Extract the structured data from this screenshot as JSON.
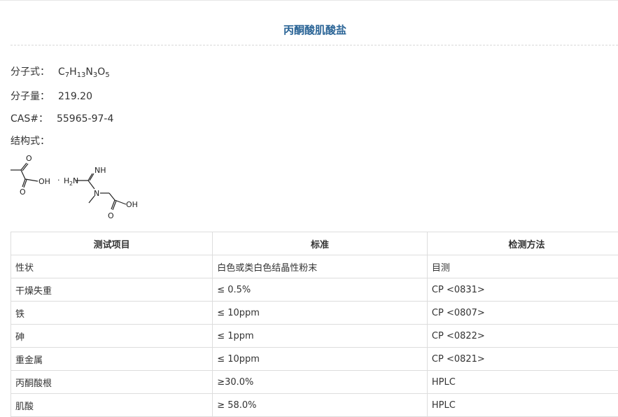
{
  "product": {
    "title": "丙酮酸肌酸盐",
    "formula_label": "分子式：",
    "formula": [
      {
        "t": "C"
      },
      {
        "s": "7"
      },
      {
        "t": "H"
      },
      {
        "s": "13"
      },
      {
        "t": "N"
      },
      {
        "s": "3"
      },
      {
        "t": "O"
      },
      {
        "s": "5"
      }
    ],
    "mw_label": "分子量：",
    "mw": "219.20",
    "cas_label": "CAS#：",
    "cas": "55965-97-4",
    "structure_label": "结构式："
  },
  "structure": {
    "o_top": "O",
    "oh_left": "OH",
    "dot": "·",
    "h2n_h": "H",
    "h2n_2": "2",
    "h2n_n": "N",
    "nh": "NH",
    "n": "N",
    "o_bottom": "O",
    "oh_right": "OH"
  },
  "spec_table": {
    "headers": [
      "测试项目",
      "标准",
      "检测方法"
    ],
    "rows": [
      [
        "性状",
        "白色或类白色结晶性粉末",
        "目测"
      ],
      [
        "干燥失重",
        "≤ 0.5%",
        "CP <0831>"
      ],
      [
        "铁",
        "≤ 10ppm",
        "CP <0807>"
      ],
      [
        "砷",
        "≤ 1ppm",
        "CP <0822>"
      ],
      [
        "重金属",
        "≤ 10ppm",
        "CP <0821>"
      ],
      [
        "丙酮酸根",
        "≥30.0%",
        "HPLC"
      ],
      [
        "肌酸",
        "≥ 58.0%",
        "HPLC"
      ]
    ]
  },
  "colors": {
    "title": "#2a6496",
    "text": "#333333",
    "border": "#dddddd"
  }
}
